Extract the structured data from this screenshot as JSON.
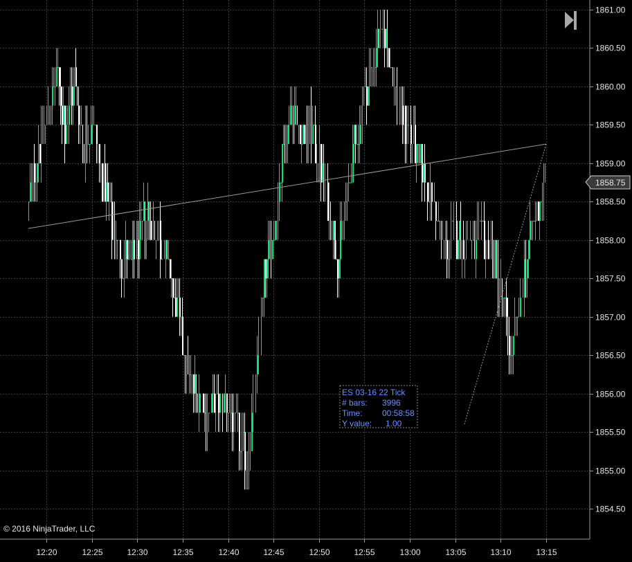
{
  "chart_data": {
    "type": "bar",
    "instrument": "ES 03-16 22 Tick",
    "y_ticks": [
      "1861.00",
      "1860.50",
      "1860.00",
      "1859.50",
      "1859.00",
      "1858.50",
      "1858.00",
      "1857.50",
      "1857.00",
      "1856.50",
      "1856.00",
      "1855.50",
      "1855.00",
      "1854.50"
    ],
    "x_ticks": [
      "12:20",
      "12:25",
      "12:30",
      "12:35",
      "12:40",
      "12:45",
      "12:50",
      "12:55",
      "13:00",
      "13:05",
      "13:10",
      "13:15"
    ],
    "ylim": [
      1854.3,
      1861.1
    ],
    "current_price": "1858.75",
    "grid": true,
    "colors": {
      "background": "#000000",
      "up_bar": "#00e676",
      "down_bar": "#ffffff",
      "grid": "#3c3c3c",
      "info": "#6f8fff",
      "price_label_bg": "#3a3a3a"
    },
    "price_path": [
      [
        "12:18",
        1858.5
      ],
      [
        "12:19",
        1859.2
      ],
      [
        "12:20",
        1859.6
      ],
      [
        "12:21",
        1860.2
      ],
      [
        "12:22",
        1859.5
      ],
      [
        "12:23",
        1860.1
      ],
      [
        "12:24",
        1859.2
      ],
      [
        "12:25",
        1859.6
      ],
      [
        "12:26",
        1858.8
      ],
      [
        "12:27",
        1858.3
      ],
      [
        "12:28",
        1857.8
      ],
      [
        "12:29",
        1857.7
      ],
      [
        "12:30",
        1857.9
      ],
      [
        "12:31",
        1858.4
      ],
      [
        "12:32",
        1858.2
      ],
      [
        "12:33",
        1857.8
      ],
      [
        "12:34",
        1857.2
      ],
      [
        "12:35",
        1856.6
      ],
      [
        "12:36",
        1856.1
      ],
      [
        "12:37",
        1855.9
      ],
      [
        "12:38",
        1855.7
      ],
      [
        "12:39",
        1856.0
      ],
      [
        "12:40",
        1855.8
      ],
      [
        "12:41",
        1855.4
      ],
      [
        "12:42",
        1855.1
      ],
      [
        "12:43",
        1856.2
      ],
      [
        "12:44",
        1857.6
      ],
      [
        "12:45",
        1858.2
      ],
      [
        "12:46",
        1859.2
      ],
      [
        "12:47",
        1859.8
      ],
      [
        "12:48",
        1859.3
      ],
      [
        "12:49",
        1859.5
      ],
      [
        "12:50",
        1859.0
      ],
      [
        "12:51",
        1858.4
      ],
      [
        "12:52",
        1857.8
      ],
      [
        "12:53",
        1858.6
      ],
      [
        "12:54",
        1859.3
      ],
      [
        "12:55",
        1859.9
      ],
      [
        "12:56",
        1860.4
      ],
      [
        "12:57",
        1860.7
      ],
      [
        "12:58",
        1860.2
      ],
      [
        "12:59",
        1859.6
      ],
      [
        "13:00",
        1859.4
      ],
      [
        "13:01",
        1859.0
      ],
      [
        "13:02",
        1858.7
      ],
      [
        "13:03",
        1858.2
      ],
      [
        "13:04",
        1857.9
      ],
      [
        "13:05",
        1858.1
      ],
      [
        "13:06",
        1858.0
      ],
      [
        "13:07",
        1857.9
      ],
      [
        "13:08",
        1858.1
      ],
      [
        "13:09",
        1857.8
      ],
      [
        "13:10",
        1857.4
      ],
      [
        "13:11",
        1856.5
      ],
      [
        "13:12",
        1857.0
      ],
      [
        "13:13",
        1858.0
      ],
      [
        "13:14",
        1858.4
      ],
      [
        "13:15",
        1858.9
      ]
    ],
    "trend_line_1": [
      [
        "12:18",
        1858.15
      ],
      [
        "13:15",
        1859.25
      ]
    ],
    "trend_line_2": [
      [
        "13:15",
        1859.25
      ],
      [
        "13:06",
        1855.6
      ]
    ]
  },
  "info_box": {
    "title": "ES 03-16 22 Tick",
    "rows": [
      {
        "label": "# bars:",
        "value": "3996"
      },
      {
        "label": "Time:",
        "value": "00:58:58"
      },
      {
        "label": "Y value:",
        "value": "1.00"
      }
    ]
  },
  "copyright": "© 2016 NinjaTrader, LLC",
  "controls": {
    "icon": "skip-to-end-icon"
  }
}
